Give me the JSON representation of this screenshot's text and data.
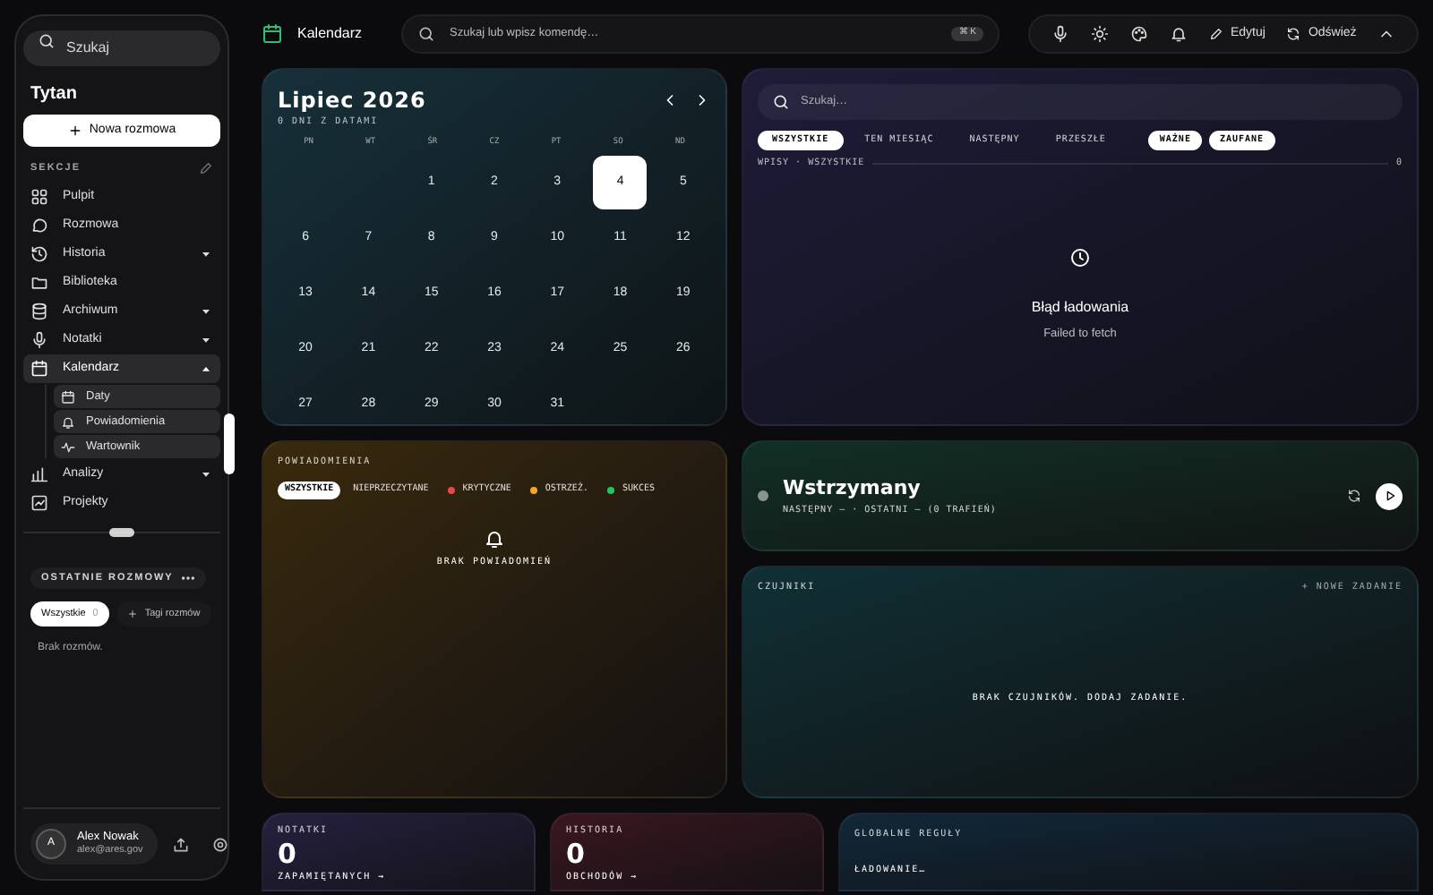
{
  "sidebar": {
    "search": {
      "placeholder": "Szukaj"
    },
    "workspace": "Tytan",
    "new_button": "Nowa rozmowa",
    "section_label": "SEKCJE",
    "items": [
      {
        "label": "Pulpit",
        "selected": false
      },
      {
        "label": "Rozmowa",
        "selected": false
      },
      {
        "label": "Historia",
        "selected": false,
        "expanded": false
      },
      {
        "label": "Biblioteka",
        "selected": false
      },
      {
        "label": "Archiwum",
        "selected": false,
        "expanded": false
      },
      {
        "label": "Notatki",
        "selected": false,
        "expanded": false
      },
      {
        "label": "Kalendarz",
        "selected": true,
        "expanded": true,
        "children": [
          {
            "label": "Daty",
            "selected": false
          },
          {
            "label": "Powiadomienia",
            "selected": false
          },
          {
            "label": "Wartownik",
            "selected": false
          }
        ]
      },
      {
        "label": "Analizy",
        "selected": false,
        "expanded": false
      },
      {
        "label": "Projekty",
        "selected": false
      }
    ],
    "recent_label": "OSTATNIE ROZMOWY",
    "recent_filters": [
      {
        "label": "Wszystkie",
        "count": "0",
        "selected": true
      },
      {
        "label": "Tagi rozmów",
        "selected": false
      }
    ],
    "empty_text": "Brak rozmów.",
    "user": {
      "initial": "A",
      "name": "Alex Nowak",
      "email": "alex@ares.gov"
    }
  },
  "header": {
    "title": "Kalendarz",
    "search_placeholder": "Szukaj lub wpisz komendę…",
    "shortcut": "⌘ K",
    "edit_button": "Edytuj",
    "refresh_button": "Odśwież"
  },
  "calendar": {
    "title": "Lipiec 2026",
    "subtitle": "0 DNI Z DATAMI",
    "weekdays": [
      "PN",
      "WT",
      "ŚR",
      "CZ",
      "PT",
      "SO",
      "ND"
    ],
    "weeks": [
      [
        {
          "label": "1",
          "selected": false
        },
        {
          "label": "2",
          "selected": false
        },
        {
          "label": "3",
          "selected": false
        },
        {
          "label": "4",
          "selected": true
        },
        {
          "label": "5",
          "selected": false
        }
      ],
      [
        {
          "label": "6",
          "selected": false
        },
        {
          "label": "7",
          "selected": false
        },
        {
          "label": "8",
          "selected": false
        },
        {
          "label": "9",
          "selected": false
        },
        {
          "label": "10",
          "selected": false
        },
        {
          "label": "11",
          "selected": false
        },
        {
          "label": "12",
          "selected": false
        }
      ],
      [
        {
          "label": "13",
          "selected": false
        },
        {
          "label": "14",
          "selected": false
        },
        {
          "label": "15",
          "selected": false
        },
        {
          "label": "16",
          "selected": false
        },
        {
          "label": "17",
          "selected": false
        },
        {
          "label": "18",
          "selected": false
        },
        {
          "label": "19",
          "selected": false
        }
      ],
      [
        {
          "label": "20",
          "selected": false
        },
        {
          "label": "21",
          "selected": false
        },
        {
          "label": "22",
          "selected": false
        },
        {
          "label": "23",
          "selected": false
        },
        {
          "label": "24",
          "selected": false
        },
        {
          "label": "25",
          "selected": false
        },
        {
          "label": "26",
          "selected": false
        }
      ],
      [
        {
          "label": "27",
          "selected": false
        },
        {
          "label": "28",
          "selected": false
        },
        {
          "label": "29",
          "selected": false
        },
        {
          "label": "30",
          "selected": false
        },
        {
          "label": "31",
          "selected": false
        }
      ]
    ]
  },
  "entries": {
    "search_placeholder": "Szukaj…",
    "filters": [
      {
        "label": "WSZYSTKIE",
        "selected": true
      },
      {
        "label": "TEN MIESIĄC",
        "selected": false
      },
      {
        "label": "NASTĘPNY",
        "selected": false
      },
      {
        "label": "PRZESZŁE",
        "selected": false
      }
    ],
    "tags": [
      {
        "label": "WAŻNE",
        "selected": true
      },
      {
        "label": "ZAUFANE",
        "selected": true
      }
    ],
    "list_label": "WPISY · WSZYSTKIE",
    "count": "0",
    "error_title": "Błąd ładowania",
    "error_text": "Failed to fetch"
  },
  "notifications": {
    "title": "POWIADOMIENIA",
    "filters": [
      {
        "label": "WSZYSTKIE",
        "selected": true
      },
      {
        "label": "NIEPRZECZYTANE",
        "selected": false
      },
      {
        "label": "KRYTYCZNE",
        "selected": false,
        "color": "#e5484d"
      },
      {
        "label": "OSTRZEŻ.",
        "selected": false,
        "color": "#f5a524"
      },
      {
        "label": "SUKCES",
        "selected": false,
        "color": "#22c55e"
      }
    ],
    "empty_text": "BRAK POWIADOMIEŃ"
  },
  "sentinel": {
    "status": "Wstrzymany",
    "detail": "NASTĘPNY — · OSTATNI — (0 TRAFIEŃ)"
  },
  "sensors": {
    "title": "CZUJNIKI",
    "add_link": "+ NOWE ZADANIE",
    "empty_text": "BRAK CZUJNIKÓW. DODAJ ZADANIE."
  },
  "stats": [
    {
      "title": "NOTATKI",
      "value": "0",
      "link": "ZAPAMIĘTANYCH →"
    },
    {
      "title": "HISTORIA",
      "value": "0",
      "link": "OBCHODÓW →"
    }
  ],
  "rules": {
    "title": "GLOBALNE REGUŁY",
    "status": "ŁADOWANIE…"
  }
}
